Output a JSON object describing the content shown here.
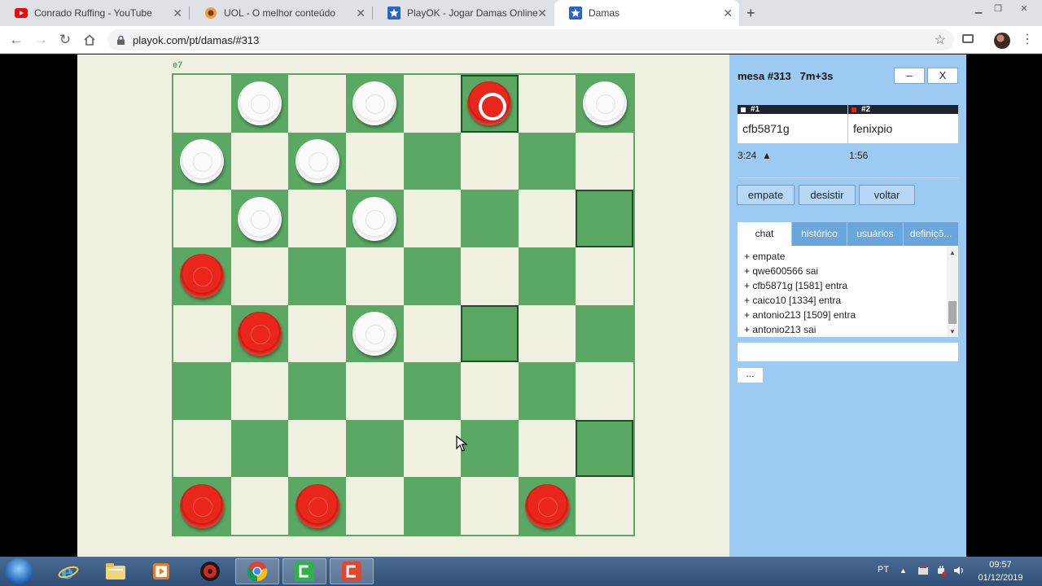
{
  "browser": {
    "tabs": [
      {
        "title": "Conrado Ruffing - YouTube",
        "icon": "youtube-icon",
        "active": false
      },
      {
        "title": "UOL - O melhor conteúdo",
        "icon": "uol-icon",
        "active": false
      },
      {
        "title": "PlayOK - Jogar Damas Online gra",
        "icon": "playok-star-icon",
        "active": false
      },
      {
        "title": "Damas",
        "icon": "playok-star-icon",
        "active": true
      }
    ],
    "new_tab": "+",
    "url": "playok.com/pt/damas/#313"
  },
  "board": {
    "coord_label": "e7",
    "colors": {
      "light": "#f0f0e1",
      "dark": "#5aa864",
      "white_piece": "#f5f5f5",
      "red_piece": "#e3241b"
    },
    "pieces": [
      {
        "row": 0,
        "col": 1,
        "color": "white"
      },
      {
        "row": 0,
        "col": 3,
        "color": "white"
      },
      {
        "row": 0,
        "col": 5,
        "color": "red",
        "selected": true
      },
      {
        "row": 0,
        "col": 7,
        "color": "white"
      },
      {
        "row": 1,
        "col": 0,
        "color": "white"
      },
      {
        "row": 1,
        "col": 2,
        "color": "white"
      },
      {
        "row": 2,
        "col": 1,
        "color": "white"
      },
      {
        "row": 2,
        "col": 3,
        "color": "white"
      },
      {
        "row": 3,
        "col": 0,
        "color": "red"
      },
      {
        "row": 4,
        "col": 1,
        "color": "red"
      },
      {
        "row": 4,
        "col": 3,
        "color": "white"
      },
      {
        "row": 7,
        "col": 0,
        "color": "red"
      },
      {
        "row": 7,
        "col": 2,
        "color": "red"
      },
      {
        "row": 7,
        "col": 6,
        "color": "red"
      }
    ],
    "highlighted": [
      {
        "row": 0,
        "col": 5
      },
      {
        "row": 2,
        "col": 7
      },
      {
        "row": 4,
        "col": 5
      },
      {
        "row": 6,
        "col": 7
      }
    ]
  },
  "panel": {
    "table_title": "mesa #313   7m+3s",
    "minimize_label": "–",
    "close_label": "X",
    "seats": [
      {
        "label": "#1",
        "name": "cfb5871g",
        "marker_color": "#ffffff"
      },
      {
        "label": "#2",
        "name": "fenixpio",
        "marker_color": "#e3241b"
      }
    ],
    "clocks": [
      "3:24  ▲",
      "1:56"
    ],
    "actions": [
      "empate",
      "desistir",
      "voltar"
    ],
    "tabs": [
      "chat",
      "histórico",
      "usuários",
      "definiçõ..."
    ],
    "chat_lines": [
      "+ empate",
      "+ qwe600566 sai",
      "+ cfb5871g [1581] entra",
      "+ caico10 [1334] entra",
      "+ antonio213 [1509] entra",
      "+ antonio213 sai"
    ],
    "more_label": "..."
  },
  "taskbar": {
    "lang": "PT",
    "time": "09:57",
    "date": "01/12/2019"
  }
}
